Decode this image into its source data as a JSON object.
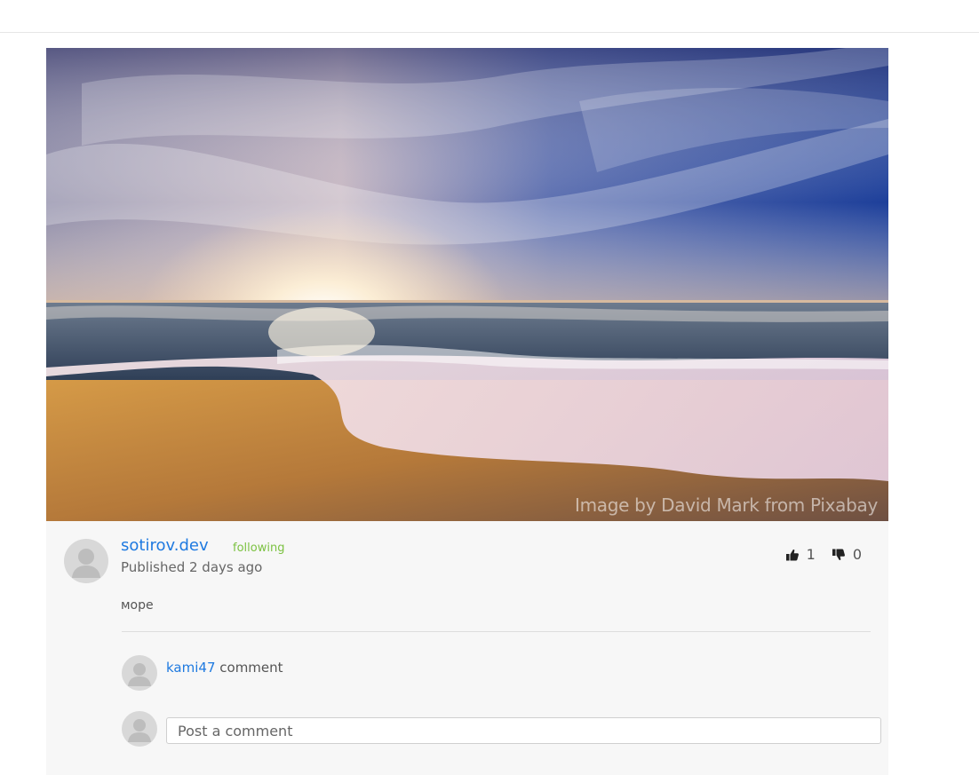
{
  "post": {
    "image_watermark": "Image by David Mark from Pixabay",
    "author": "sotirov.dev",
    "follow_status": "following",
    "published": "Published 2 days ago",
    "likes": "1",
    "dislikes": "0",
    "text": "море"
  },
  "comments": [
    {
      "author": "kami47",
      "text": "comment"
    }
  ],
  "comment_form": {
    "placeholder": "Post a comment"
  },
  "icons": {
    "like": "thumbs-up-icon",
    "dislike": "thumbs-down-icon",
    "avatar": "user-avatar-icon"
  },
  "colors": {
    "link": "#1f7ae0",
    "following": "#7cc242",
    "card_background": "#f7f7f7"
  }
}
